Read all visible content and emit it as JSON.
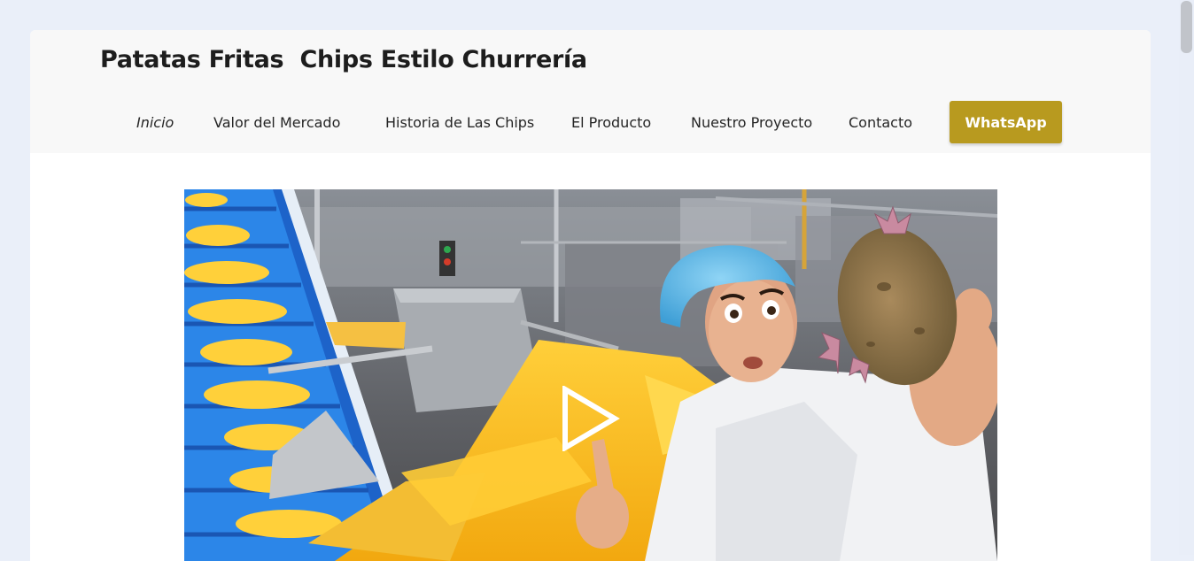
{
  "site": {
    "title": "Patatas Fritas  Chips Estilo Churrería"
  },
  "nav": {
    "items": [
      {
        "label": "Inicio",
        "active": true
      },
      {
        "label": "Valor del Mercado",
        "active": false
      },
      {
        "label": "Historia de Las Chips",
        "active": false
      },
      {
        "label": "El Producto",
        "active": false
      },
      {
        "label": "Nuestro Proyecto",
        "active": false
      },
      {
        "label": "Contacto",
        "active": false
      }
    ],
    "whatsapp_label": "WhatsApp"
  },
  "video": {
    "thumbnail_subject": "potato-chip-factory-conveyor",
    "play_icon": "play-icon"
  },
  "colors": {
    "page_background": "#eaeff9",
    "header_background": "#f8f8f8",
    "accent": "#b89a1f",
    "text": "#252525"
  }
}
